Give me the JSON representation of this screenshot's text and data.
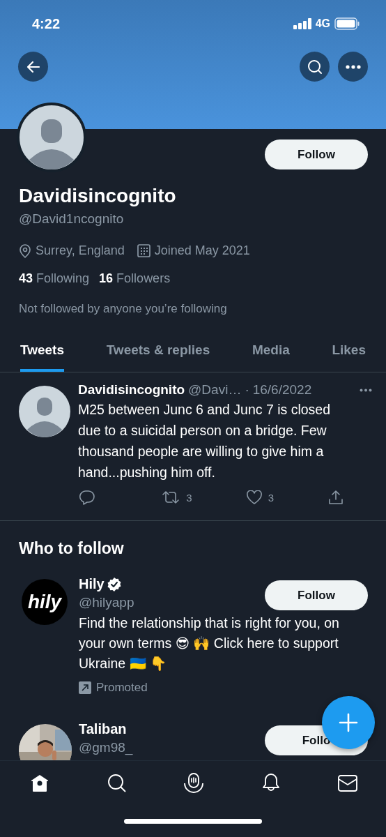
{
  "status_bar": {
    "time": "4:22",
    "network": "4G"
  },
  "profile": {
    "name": "Davidisincognito",
    "handle": "@David1ncognito",
    "location": "Surrey, England",
    "joined": "Joined May 2021",
    "following_count": "43",
    "following_label": "Following",
    "followers_count": "16",
    "followers_label": "Followers",
    "note": "Not followed by anyone you’re following",
    "follow_label": "Follow"
  },
  "tabs": [
    {
      "label": "Tweets",
      "selected": true
    },
    {
      "label": "Tweets & replies",
      "selected": false
    },
    {
      "label": "Media",
      "selected": false
    },
    {
      "label": "Likes",
      "selected": false
    }
  ],
  "tweet": {
    "name": "Davidisincognito",
    "handle": "@Davi…",
    "separator": "·",
    "date": "16/6/2022",
    "text": "M25 between Junc 6 and Junc 7 is closed due to a suicidal person on a bridge. Few thousand people are willing to give him a hand...pushing him off.",
    "actions": [
      {
        "kind": "reply"
      },
      {
        "kind": "retweet",
        "count": "3"
      },
      {
        "kind": "like",
        "count": "3"
      },
      {
        "kind": "share"
      }
    ]
  },
  "who_to_follow": {
    "title": "Who to follow",
    "accounts": [
      {
        "kind": "logo",
        "logo_text": "hily",
        "name": "Hily",
        "verified": true,
        "handle": "@hilyapp",
        "bio": "Find the relationship that is right for you, on your own terms 😎 🙌 Click here to support Ukraine 🇺🇦 👇",
        "promoted": "Promoted",
        "follow_label": "Follow"
      },
      {
        "kind": "picture",
        "name": "Taliban",
        "verified": false,
        "handle": "@gm98_",
        "follow_label": "Follo"
      }
    ]
  },
  "bottom_nav": [
    {
      "selected": true
    },
    {
      "selected": false
    },
    {
      "selected": false
    },
    {
      "selected": false
    },
    {
      "selected": false
    }
  ]
}
